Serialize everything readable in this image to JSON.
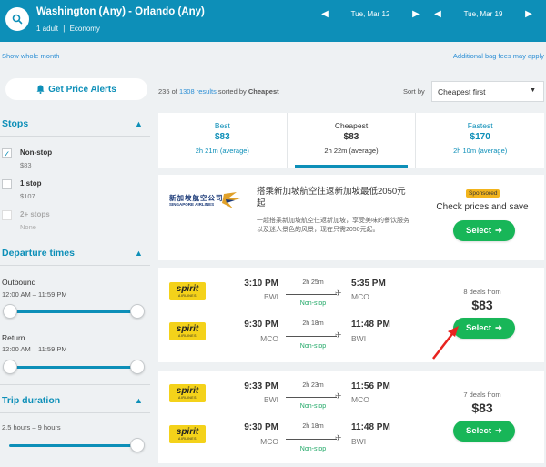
{
  "header": {
    "route": "Washington (Any) - Orlando (Any)",
    "travelers": "1 adult",
    "cabin": "Economy",
    "depart_date": "Tue, Mar 12",
    "return_date": "Tue, Mar 19",
    "color": "#0d8fb8"
  },
  "subbar": {
    "show_month": "Show whole month",
    "bag_fees": "Additional bag fees may apply"
  },
  "price_alerts": {
    "label": "Get Price Alerts"
  },
  "results": {
    "shown": "235",
    "of": "of",
    "total": "1308 results",
    "sorted": "sorted by",
    "sort_key": "Cheapest"
  },
  "sort": {
    "label": "Sort by",
    "selected": "Cheapest first"
  },
  "filters": {
    "stops": {
      "title": "Stops",
      "options": [
        {
          "label": "Non-stop",
          "price": "$83",
          "checked": true
        },
        {
          "label": "1 stop",
          "price": "$107",
          "checked": false
        },
        {
          "label": "2+ stops",
          "price": "None",
          "checked": false
        }
      ]
    },
    "departure": {
      "title": "Departure times",
      "outbound_label": "Outbound",
      "outbound_range": "12:00 AM – 11:59 PM",
      "return_label": "Return",
      "return_range": "12:00 AM – 11:59 PM"
    },
    "duration": {
      "title": "Trip duration",
      "range": "2.5 hours – 9 hours"
    }
  },
  "tabs": [
    {
      "name": "Best",
      "price": "$83",
      "duration": "2h 21m (average)"
    },
    {
      "name": "Cheapest",
      "price": "$83",
      "duration": "2h 22m (average)"
    },
    {
      "name": "Fastest",
      "price": "$170",
      "duration": "2h 10m (average)"
    }
  ],
  "ad": {
    "logo_cn": "新加坡航空公司",
    "logo_en": "SINGAPORE AIRLINES",
    "title": "搭乘新加坡航空往返新加坡最低2050元起",
    "body": "一起搭乘新加坡航空往返新加坡，享受美味的餐饮服务以及迷人景色的风景，现在只需2050元起。",
    "sponsored": "Sponsored",
    "cta": "Check prices and save",
    "select": "Select"
  },
  "results_list": [
    {
      "deals": "8 deals from",
      "price": "$83",
      "select": "Select",
      "flights": [
        {
          "airline": "spirit",
          "dep_time": "3:10 PM",
          "dep_code": "BWI",
          "duration": "2h 25m",
          "stops": "Non-stop",
          "arr_time": "5:35 PM",
          "arr_code": "MCO"
        },
        {
          "airline": "spirit",
          "dep_time": "9:30 PM",
          "dep_code": "MCO",
          "duration": "2h 18m",
          "stops": "Non-stop",
          "arr_time": "11:48 PM",
          "arr_code": "BWI"
        }
      ]
    },
    {
      "deals": "7 deals from",
      "price": "$83",
      "select": "Select",
      "flights": [
        {
          "airline": "spirit",
          "dep_time": "9:33 PM",
          "dep_code": "BWI",
          "duration": "2h 23m",
          "stops": "Non-stop",
          "arr_time": "11:56 PM",
          "arr_code": "MCO"
        },
        {
          "airline": "spirit",
          "dep_time": "9:30 PM",
          "dep_code": "MCO",
          "duration": "2h 18m",
          "stops": "Non-stop",
          "arr_time": "11:48 PM",
          "arr_code": "BWI"
        }
      ]
    }
  ],
  "colors": {
    "brand": "#0d8fb8",
    "select_green": "#18b658",
    "nonstop_green": "#1ea765",
    "spirit_yellow": "#f4d21a",
    "annotation_red": "#e8231f"
  }
}
